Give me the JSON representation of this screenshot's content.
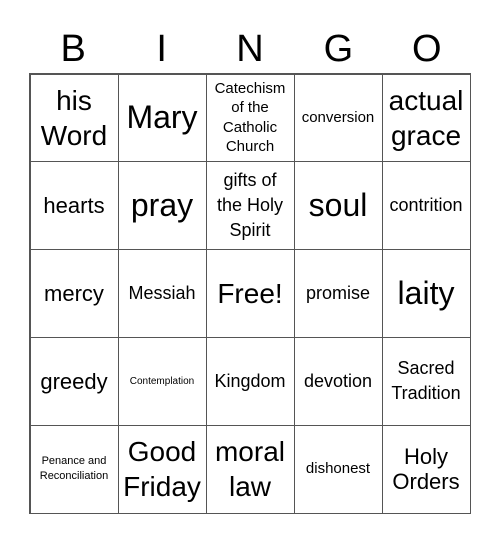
{
  "header": {
    "letters": [
      "B",
      "I",
      "N",
      "G",
      "O"
    ]
  },
  "board": {
    "cells": [
      [
        "his Word",
        "Mary",
        "Catechism of the Catholic Church",
        "conversion",
        "actual grace"
      ],
      [
        "hearts",
        "pray",
        "gifts of the Holy Spirit",
        "soul",
        "contrition"
      ],
      [
        "mercy",
        "Messiah",
        "Free!",
        "promise",
        "laity"
      ],
      [
        "greedy",
        "Contemplation",
        "Kingdom",
        "devotion",
        "Sacred Tradition"
      ],
      [
        "Penance and Reconciliation",
        "Good Friday",
        "moral law",
        "dishonest",
        "Holy Orders"
      ]
    ]
  }
}
